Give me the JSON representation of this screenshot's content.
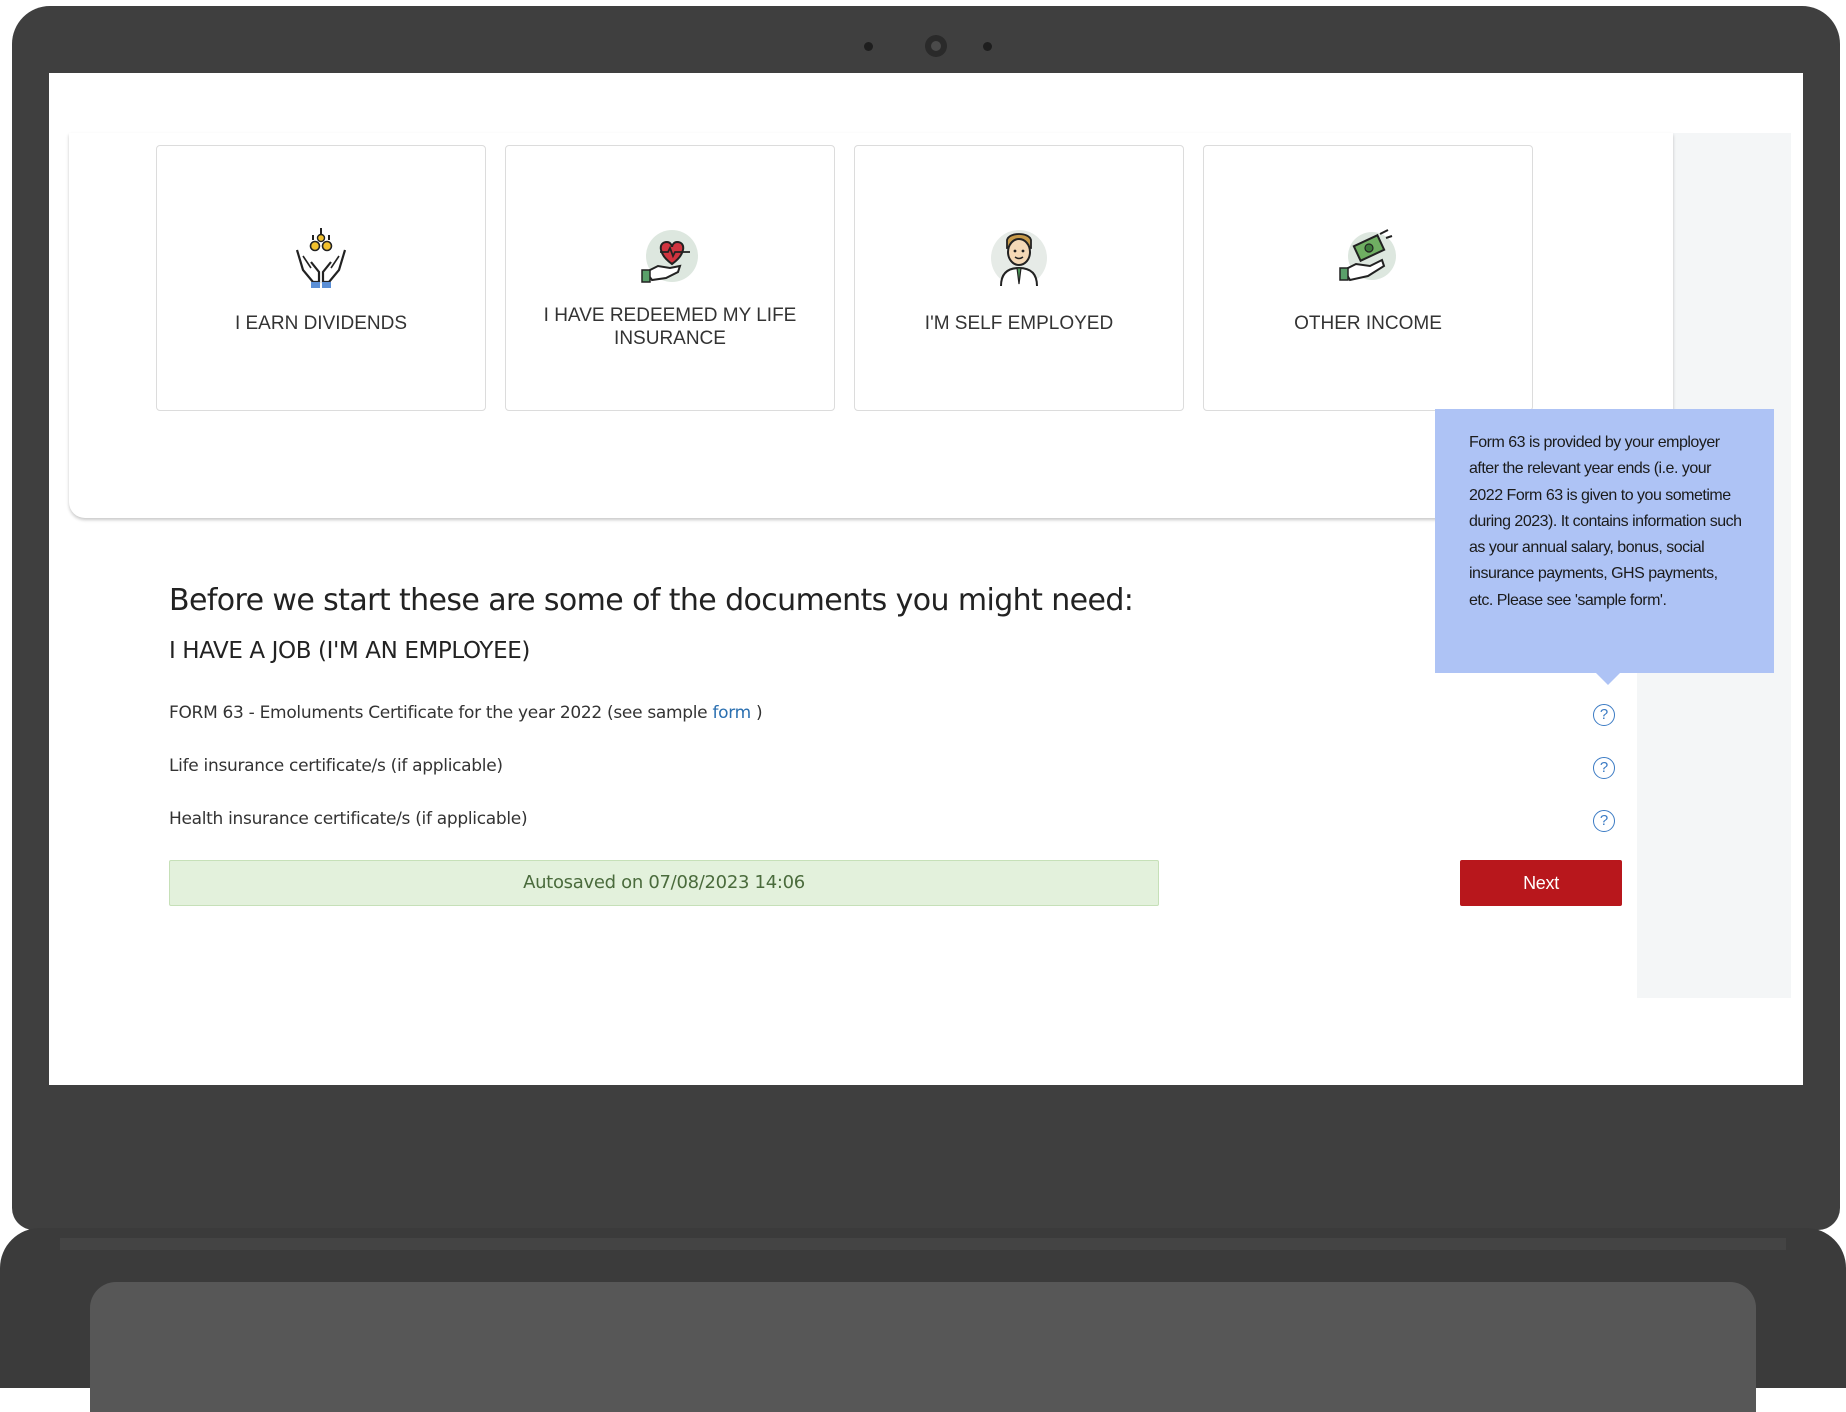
{
  "income_cards": [
    {
      "label": "I EARN DIVIDENDS",
      "icon": "dividends-hands-icon"
    },
    {
      "label": "I HAVE REDEEMED MY LIFE INSURANCE",
      "icon": "heart-hand-icon"
    },
    {
      "label": "I'M SELF EMPLOYED",
      "icon": "businessman-icon"
    },
    {
      "label": "OTHER INCOME",
      "icon": "money-hand-icon"
    }
  ],
  "documents": {
    "heading": "Before we start these are some of the documents you might need:",
    "subheading": "I HAVE A JOB (I'M AN EMPLOYEE)",
    "items": [
      {
        "text": "FORM 63 - Emoluments Certificate for the year 2022 (see sample ",
        "link": "form",
        "suffix": " )"
      },
      {
        "text": "Life insurance certificate/s (if applicable)"
      },
      {
        "text": "Health insurance certificate/s (if applicable)"
      }
    ],
    "help_glyph": "?"
  },
  "tooltip": {
    "text": "Form 63 is provided by your employer after the relevant year ends (i.e. your 2022 Form 63 is given to you sometime during 2023). It contains information such as your annual salary, bonus, social insurance payments, GHS payments, etc. Please see 'sample form'."
  },
  "autosave_text": "Autosaved on 07/08/2023 14:06",
  "next_label": "Next",
  "colors": {
    "accent_red": "#b8171c",
    "link_blue": "#2a6fb0",
    "tooltip_bg": "#aec3f5",
    "autosave_bg": "#e3f1dc"
  }
}
